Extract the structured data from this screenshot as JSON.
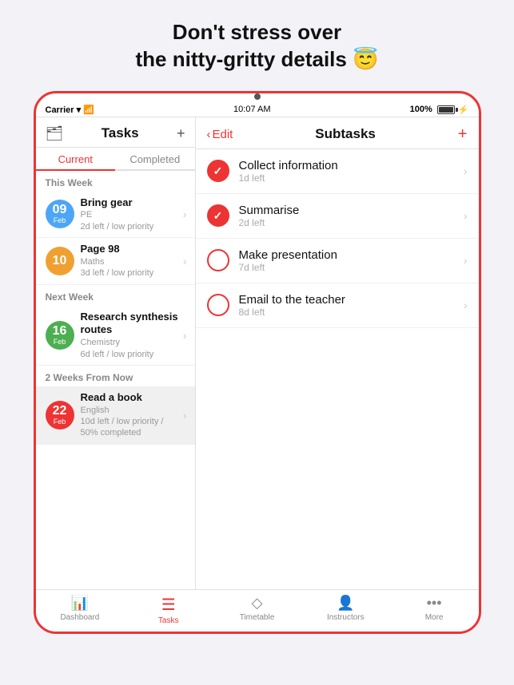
{
  "headline": {
    "line1": "Don't stress over",
    "line2": "the nitty-gritty details 😇"
  },
  "status_bar": {
    "carrier": "Carrier",
    "wifi_icon": "📶",
    "time": "10:07 AM",
    "battery": "100%"
  },
  "camera_dot": true,
  "left_panel": {
    "title": "Tasks",
    "tabs": [
      {
        "label": "Current",
        "active": true
      },
      {
        "label": "Completed",
        "active": false
      }
    ],
    "sections": [
      {
        "label": "This Week",
        "tasks": [
          {
            "day": "09",
            "month": "Feb",
            "color": "#4da6f5",
            "title": "Bring gear",
            "subtitle": "PE",
            "meta": "2d left / low priority"
          },
          {
            "day": "10",
            "month": "",
            "color": "#f0a030",
            "title": "Page 98",
            "subtitle": "Maths",
            "meta": "3d left / low priority"
          }
        ]
      },
      {
        "label": "Next Week",
        "tasks": [
          {
            "day": "16",
            "month": "Feb",
            "color": "#4caf50",
            "title": "Research synthesis routes",
            "subtitle": "Chemistry",
            "meta": "6d left / low priority"
          }
        ]
      },
      {
        "label": "2 Weeks From Now",
        "tasks": [
          {
            "day": "22",
            "month": "Feb",
            "color": "#e33",
            "title": "Read a book",
            "subtitle": "English",
            "meta": "10d left / low priority / 50% completed",
            "selected": true
          }
        ]
      }
    ]
  },
  "right_panel": {
    "edit_label": "Edit",
    "title": "Subtasks",
    "plus_label": "+",
    "subtasks": [
      {
        "title": "Collect information",
        "meta": "1d left",
        "checked": true
      },
      {
        "title": "Summarise",
        "meta": "2d left",
        "checked": true
      },
      {
        "title": "Make presentation",
        "meta": "7d left",
        "checked": false
      },
      {
        "title": "Email to the teacher",
        "meta": "8d left",
        "checked": false
      }
    ]
  },
  "bottom_nav": {
    "items": [
      {
        "label": "Dashboard",
        "icon": "📊",
        "active": false
      },
      {
        "label": "Tasks",
        "icon": "≡",
        "active": true
      },
      {
        "label": "Timetable",
        "icon": "◇",
        "active": false
      },
      {
        "label": "Instructors",
        "icon": "👤",
        "active": false
      },
      {
        "label": "More",
        "icon": "•••",
        "active": false
      }
    ]
  }
}
